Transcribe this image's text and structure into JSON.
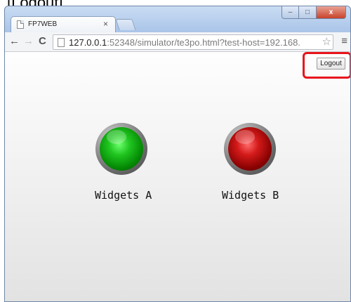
{
  "caption": "[Logout]",
  "window": {
    "controls": {
      "minimize": "–",
      "maximize": "□",
      "close": "x"
    }
  },
  "tab": {
    "title": "FP7WEB",
    "close": "×"
  },
  "toolbar": {
    "back": "←",
    "forward": "→",
    "reload": "C",
    "url_host": "127.0.0.1",
    "url_rest": ":52348/simulator/te3po.html?test-host=192.168.",
    "star": "☆",
    "menu": "≡"
  },
  "page": {
    "logout_label": "Logout",
    "widgets": [
      {
        "label": "Widgets A",
        "state": "green",
        "color": "#1fbf1f"
      },
      {
        "label": "Widgets B",
        "state": "red",
        "color": "#c41212"
      }
    ]
  },
  "colors": {
    "highlight": "#e8141c"
  }
}
